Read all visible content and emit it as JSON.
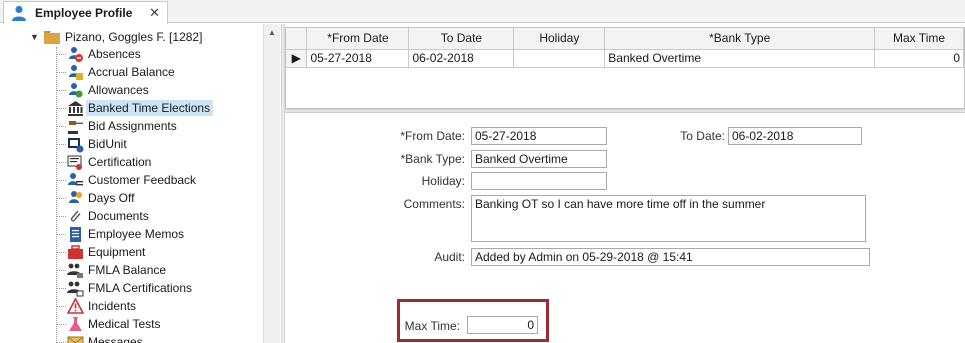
{
  "tab": {
    "title": "Employee Profile",
    "close_glyph": "✕"
  },
  "tree": {
    "root_label": "Pizano, Goggles F. [1282]",
    "items": [
      {
        "label": "Absences",
        "icon": "absences-icon"
      },
      {
        "label": "Accrual Balance",
        "icon": "accrual-balance-icon"
      },
      {
        "label": "Allowances",
        "icon": "allowances-icon"
      },
      {
        "label": "Banked Time Elections",
        "icon": "bank-icon",
        "selected": true
      },
      {
        "label": "Bid Assignments",
        "icon": "gavel-icon"
      },
      {
        "label": "BidUnit",
        "icon": "bidunit-icon"
      },
      {
        "label": "Certification",
        "icon": "certificate-icon"
      },
      {
        "label": "Customer Feedback",
        "icon": "customer-feedback-icon"
      },
      {
        "label": "Days Off",
        "icon": "days-off-icon"
      },
      {
        "label": "Documents",
        "icon": "paperclip-icon"
      },
      {
        "label": "Employee Memos",
        "icon": "memo-icon"
      },
      {
        "label": "Equipment",
        "icon": "equipment-icon"
      },
      {
        "label": "FMLA Balance",
        "icon": "fmla-balance-icon"
      },
      {
        "label": "FMLA Certifications",
        "icon": "fmla-certifications-icon"
      },
      {
        "label": "Incidents",
        "icon": "warning-icon"
      },
      {
        "label": "Medical Tests",
        "icon": "flask-icon"
      },
      {
        "label": "Messages",
        "icon": "envelope-icon"
      }
    ]
  },
  "grid": {
    "columns": [
      "*From Date",
      "To Date",
      "Holiday",
      "*Bank Type",
      "Max Time"
    ],
    "rows": [
      {
        "from": "05-27-2018",
        "to": "06-02-2018",
        "holiday": "",
        "bank_type": "Banked Overtime",
        "max_time": "0"
      }
    ],
    "row_indicator": "▶"
  },
  "form": {
    "from_date_label": "*From Date:",
    "from_date_value": "05-27-2018",
    "to_date_label": "To Date:",
    "to_date_value": "06-02-2018",
    "bank_type_label": "*Bank Type:",
    "bank_type_value": "Banked Overtime",
    "holiday_label": "Holiday:",
    "holiday_value": "",
    "comments_label": "Comments:",
    "comments_value": "Banking OT so I can have more time off in the summer",
    "audit_label": "Audit:",
    "audit_value": "Added by Admin on 05-29-2018 @ 15:41",
    "max_time_label": "Max Time:",
    "max_time_value": "0"
  },
  "colors": {
    "highlight_border": "#9b2c30",
    "selection": "#cde4f7"
  }
}
